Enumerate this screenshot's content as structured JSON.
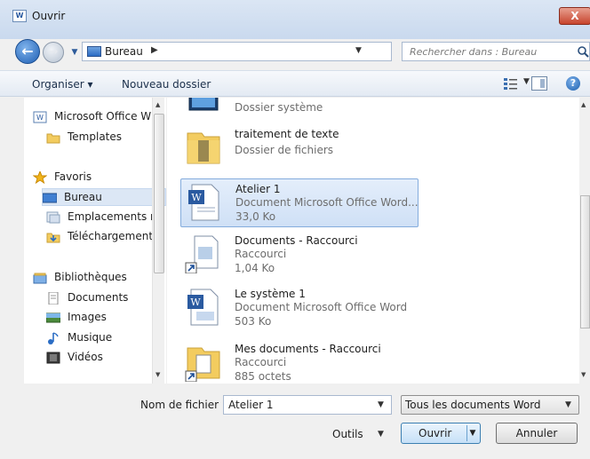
{
  "window": {
    "title": "Ouvrir",
    "title_icon_text": "W",
    "close_symbol": "X"
  },
  "navigation": {
    "address": {
      "location": "Bureau",
      "separator": "▶"
    },
    "search": {
      "placeholder": "Rechercher dans : Bureau"
    }
  },
  "toolbar": {
    "organize_label": "Organiser ▾",
    "new_folder_label": "Nouveau dossier"
  },
  "nav_pane": {
    "items": [
      {
        "label": "Microsoft Office W",
        "icon": "word-app-icon"
      },
      {
        "label": "Templates",
        "icon": "folder-icon"
      },
      {
        "label": "Favoris",
        "icon": "star-icon"
      },
      {
        "label": "Bureau",
        "icon": "desktop-icon",
        "selected": true
      },
      {
        "label": "Emplacements ré",
        "icon": "recent-places-icon"
      },
      {
        "label": "Téléchargements",
        "icon": "downloads-icon"
      },
      {
        "label": "Bibliothèques",
        "icon": "libraries-icon"
      },
      {
        "label": "Documents",
        "icon": "documents-icon"
      },
      {
        "label": "Images",
        "icon": "images-icon"
      },
      {
        "label": "Musique",
        "icon": "music-icon"
      },
      {
        "label": "Vidéos",
        "icon": "videos-icon"
      }
    ]
  },
  "files": {
    "items": [
      {
        "name": "",
        "type": "Dossier système",
        "size": ""
      },
      {
        "name": "traitement de texte",
        "type": "Dossier de fichiers",
        "size": ""
      },
      {
        "name": "Atelier 1",
        "type": "Document Microsoft Office Word...",
        "size": "33,0 Ko",
        "selected": true
      },
      {
        "name": "Documents - Raccourci",
        "type": "Raccourci",
        "size": "1,04 Ko"
      },
      {
        "name": "Le système 1",
        "type": "Document Microsoft Office Word",
        "size": "503 Ko"
      },
      {
        "name": "Mes documents - Raccourci",
        "type": "Raccourci",
        "size": "885 octets"
      }
    ]
  },
  "bottom": {
    "filename_label": "Nom de fichier :",
    "filename_value": "Atelier 1",
    "filetype_value": "Tous les documents Word",
    "tools_label": "Outils",
    "open_label": "Ouvrir",
    "cancel_label": "Annuler"
  },
  "colors": {
    "accent": "#2a6cc4",
    "selection": "#cfe0f6",
    "close": "#c7442d"
  }
}
